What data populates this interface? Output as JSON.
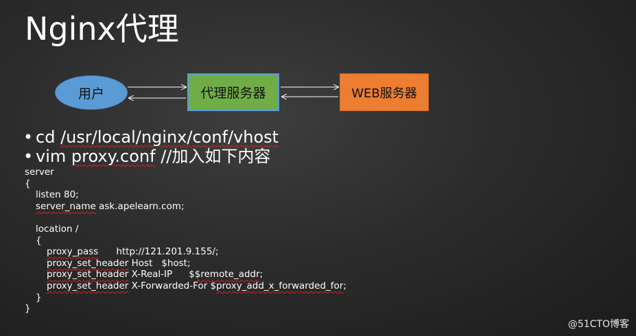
{
  "slide": {
    "title": "Nginx代理"
  },
  "diagram": {
    "user": "用户",
    "proxy": "代理服务器",
    "web": "WEB服务器"
  },
  "bullets": {
    "b1_prefix": "cd ",
    "b1_path": "/usr/local/nginx/conf/vhost",
    "b2_prefix": "vim ",
    "b2_file": "proxy.conf",
    "b2_suffix": " //加入如下内容"
  },
  "code": {
    "l01": "server",
    "l02": "{",
    "l03": "listen 80;",
    "l04_key": "server_name",
    "l04_val": " ask.apelearn.com;",
    "l06": "location /",
    "l07": "{",
    "l08_key": "proxy_pass",
    "l08_val": "http://121.201.9.155/;",
    "l09_key": "proxy_set_header",
    "l09_val": " Host   $host;",
    "l10_key": "proxy_set_header",
    "l10_mid": " X-Real-IP",
    "l10_var": "$remote_addr",
    "l10_end": ";",
    "l11_key": "proxy_set_header",
    "l11_mid": " X-Forwarded-For $",
    "l11_var": "proxy_add_x_forwarded_for",
    "l11_end": ";",
    "l12": "}",
    "l13": "}"
  },
  "watermark": "@51CTO博客",
  "colors": {
    "user_node": "#5b9bd5",
    "proxy_node": "#70ad47",
    "web_node": "#ed7d31",
    "squiggle": "#e02020"
  }
}
